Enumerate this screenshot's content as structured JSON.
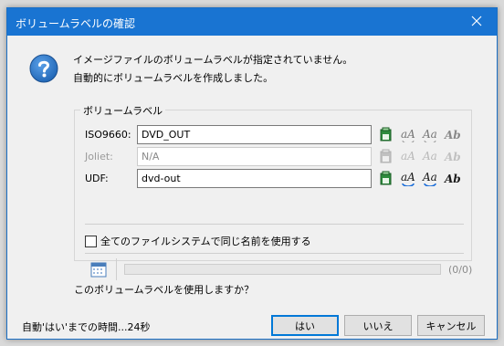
{
  "window": {
    "title": "ボリュームラベルの確認"
  },
  "message": {
    "line1": "イメージファイルのボリュームラベルが指定されていません。",
    "line2": "自動的にボリュームラベルを作成しました。"
  },
  "group": {
    "title": "ボリュームラベル",
    "rows": [
      {
        "label": "ISO9660:",
        "value": "DVD_OUT",
        "enabled": true
      },
      {
        "label": "Joliet:",
        "value": "N/A",
        "enabled": false
      },
      {
        "label": "UDF:",
        "value": "dvd-out",
        "enabled": true
      }
    ],
    "same_name_checkbox": {
      "label": "全てのファイルシステムで同じ名前を使用する",
      "checked": false
    },
    "progress": {
      "count_text": "(0/0)",
      "fraction": 0
    }
  },
  "question": "このボリュームラベルを使用しますか？",
  "countdown": "自動'はい'までの時間...24秒",
  "buttons": {
    "yes": "はい",
    "no": "いいえ",
    "cancel": "キャンセル"
  },
  "colors": {
    "titlebar": "#1974d2",
    "accent": "#0078d7",
    "question_icon": "#1e64b4"
  },
  "icons": {
    "title_close": "close-icon",
    "question": "question-icon",
    "row_buttons": [
      "apply-label-icon",
      "lowercase-icon",
      "uppercase-icon",
      "capitalize-icon"
    ],
    "calendar": "calendar-icon"
  }
}
